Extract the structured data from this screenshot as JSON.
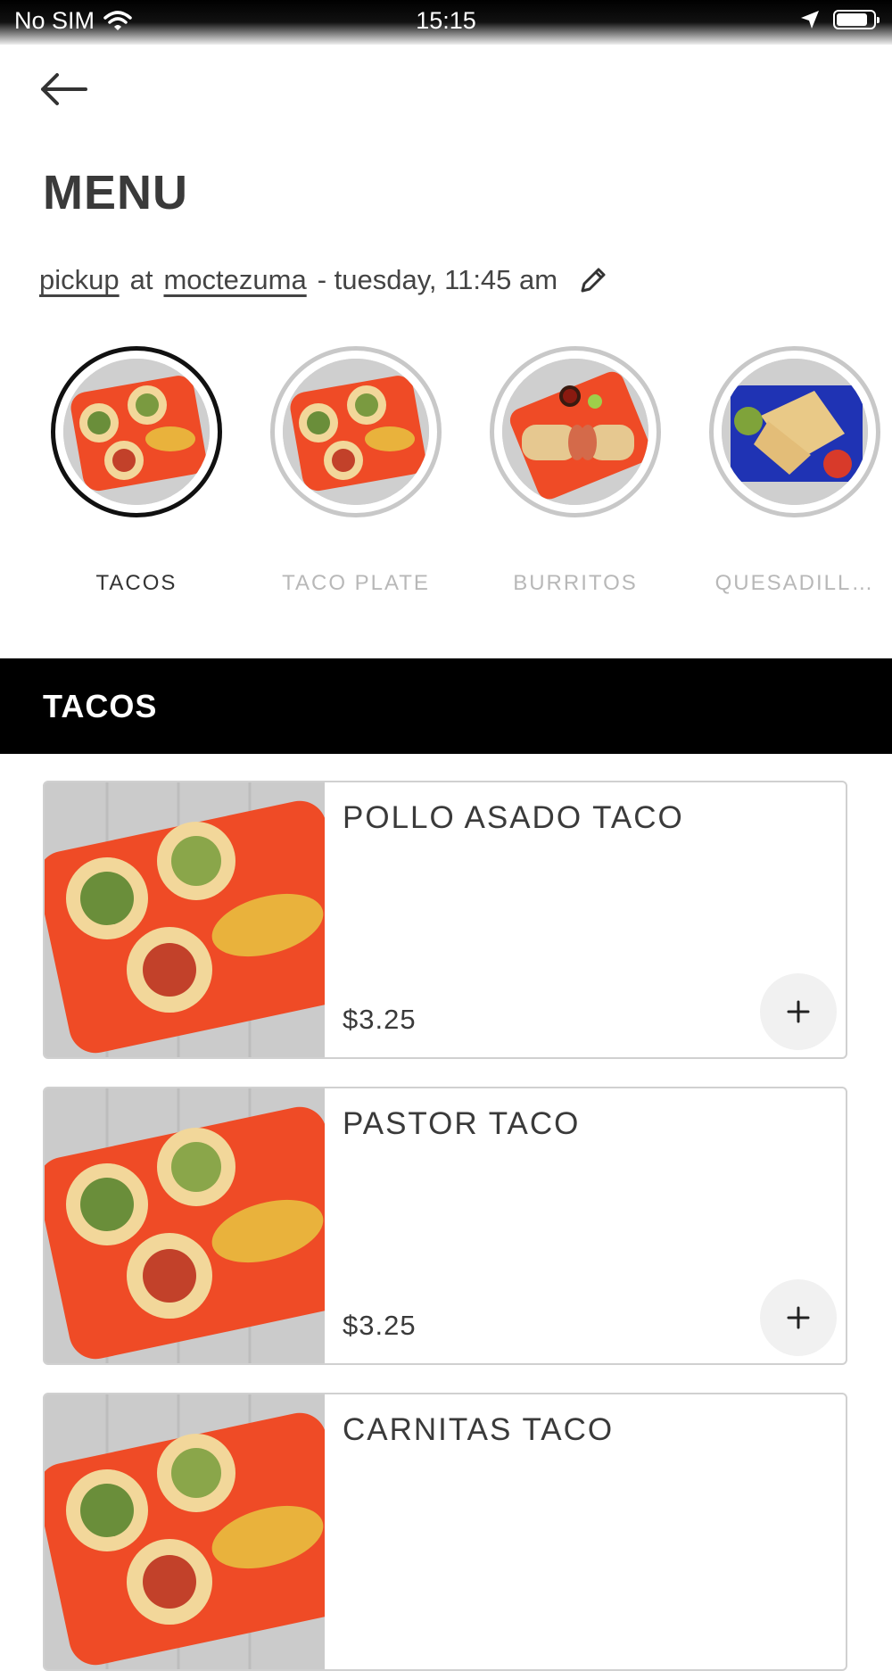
{
  "status_bar": {
    "carrier": "No SIM",
    "time": "15:15",
    "icons": [
      "wifi-icon",
      "location-arrow-icon",
      "battery-icon"
    ]
  },
  "header": {
    "back_icon": "arrow-left-icon",
    "title": "MENU",
    "order_mode": "pickup",
    "connector": "at",
    "location": "moctezuma",
    "schedule": "- tuesday, 11:45 am",
    "edit_icon": "pencil-icon"
  },
  "categories": [
    {
      "label": "TACOS",
      "image": "tacos-plate-photo",
      "active": true
    },
    {
      "label": "TACO PLATE",
      "image": "tacos-plate-photo",
      "active": false
    },
    {
      "label": "BURRITOS",
      "image": "burrito-plate-photo",
      "active": false
    },
    {
      "label": "QUESADILL…",
      "image": "quesadilla-plate-photo",
      "active": false
    }
  ],
  "section": {
    "title": "TACOS"
  },
  "items": [
    {
      "name": "POLLO ASADO TACO",
      "price": "$3.25",
      "image": "tacos-plate-photo",
      "action_icon": "plus-icon"
    },
    {
      "name": "PASTOR TACO",
      "price": "$3.25",
      "image": "tacos-plate-photo",
      "action_icon": "plus-icon"
    },
    {
      "name": "CARNITAS TACO",
      "price": "",
      "image": "tacos-plate-photo",
      "action_icon": "plus-icon"
    }
  ],
  "colors": {
    "section_bar": "#000000",
    "plate_orange": "#ef4b26",
    "plate_blue": "#1f33b4",
    "active_ring": "#111111",
    "inactive_ring": "#c8c8c8"
  }
}
